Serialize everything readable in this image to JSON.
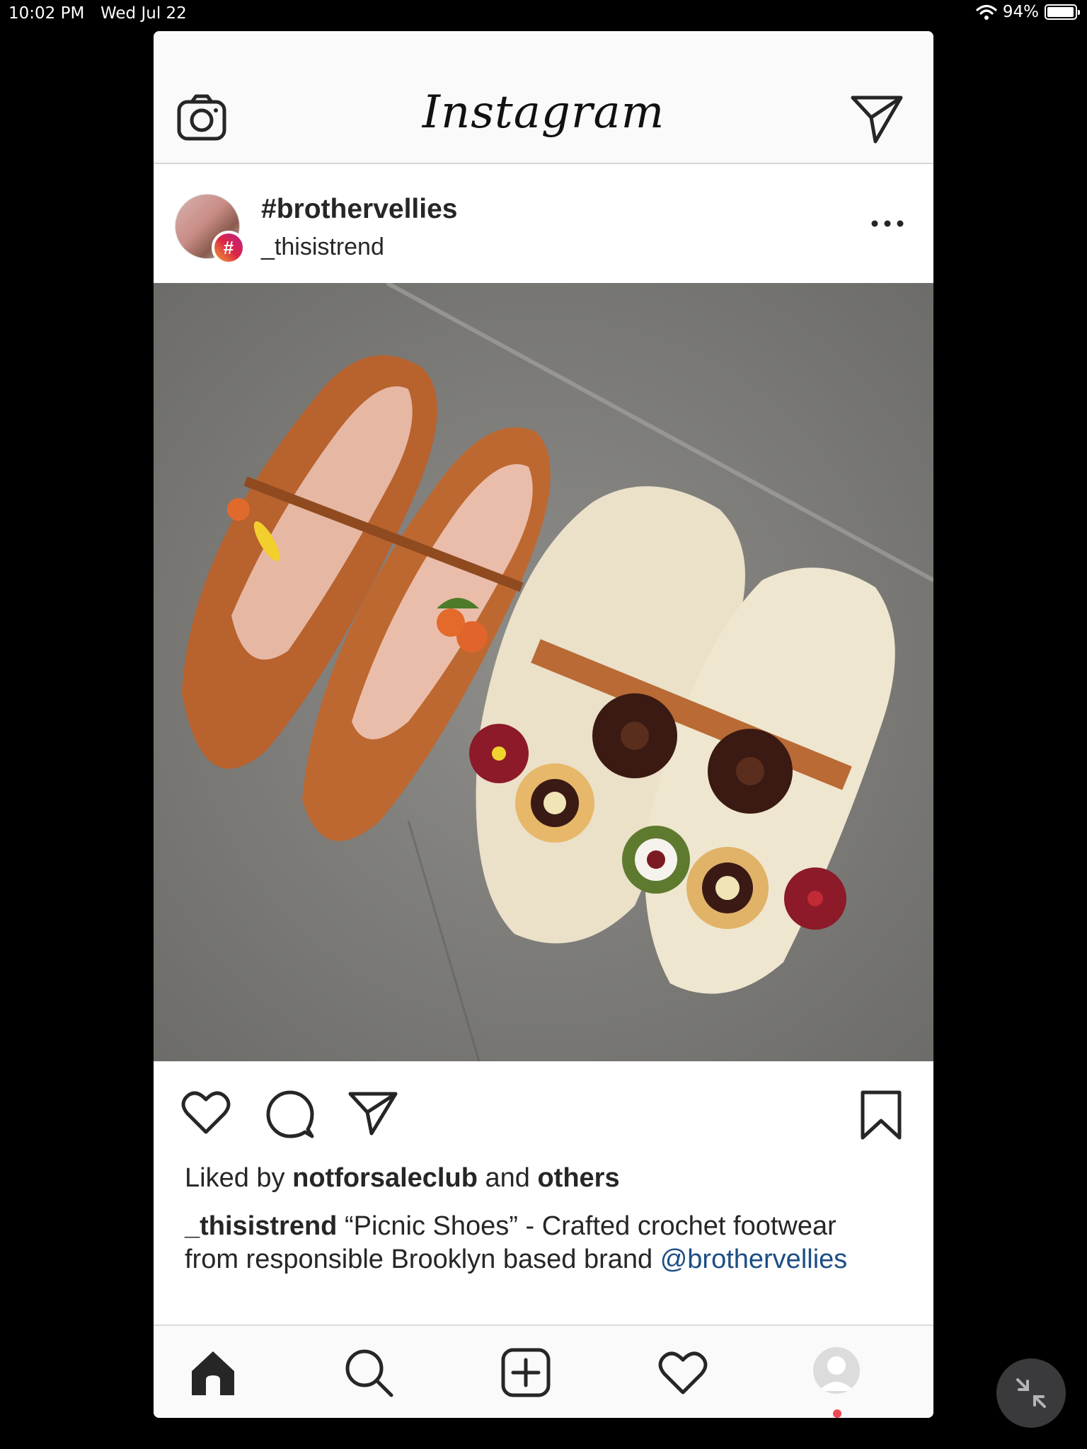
{
  "status_bar": {
    "time": "10:02 PM",
    "date": "Wed Jul 22",
    "battery": "94%"
  },
  "header": {
    "logo": "Instagram"
  },
  "post": {
    "title": "#brothervellies",
    "subtitle": "_thisistrend",
    "hashtag_badge": "#",
    "likes": {
      "prefix": "Liked by",
      "user": "notforsaleclub",
      "middle": "and",
      "others": "others"
    },
    "caption": {
      "user": "_thisistrend",
      "text": " “Picnic Shoes” - Crafted crochet footwear from responsible Brooklyn based brand ",
      "mention": "@brothervellies"
    }
  },
  "icons": {
    "camera": "camera-icon",
    "direct": "paper-plane-icon",
    "more": "more-icon",
    "like": "heart-icon",
    "comment": "comment-icon",
    "share": "paper-plane-icon",
    "save": "bookmark-icon",
    "home": "home-icon",
    "search": "search-icon",
    "add": "add-post-icon",
    "activity": "heart-icon",
    "profile": "profile-icon",
    "zoom": "minimize-icon"
  },
  "colors": {
    "mention": "#1c4e85",
    "notification_dot": "#ed4956"
  }
}
